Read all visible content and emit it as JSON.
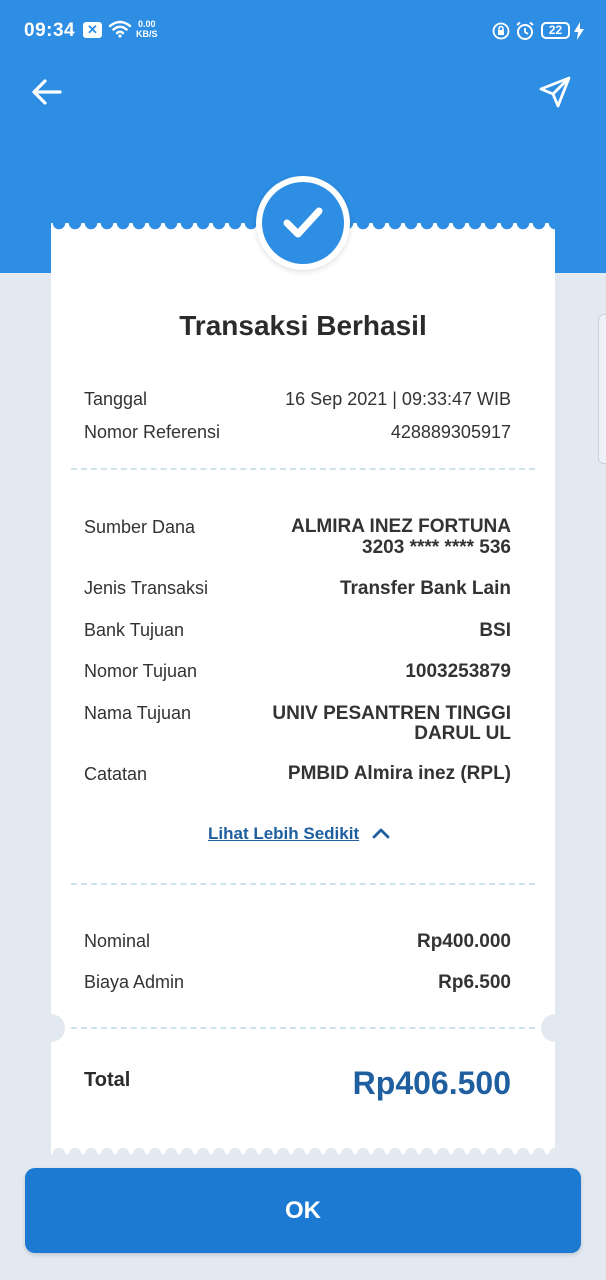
{
  "status_bar": {
    "time": "09:34",
    "notification_icon": "close-box-icon",
    "wifi_icon": "wifi-icon",
    "net_speed_value": "0.00",
    "net_speed_unit": "KB/S",
    "battery_level": "22"
  },
  "header": {
    "back_icon": "arrow-left-icon",
    "share_icon": "send-icon"
  },
  "receipt": {
    "title": "Transaksi Berhasil",
    "date_label": "Tanggal",
    "date_value": "16 Sep 2021 | 09:33:47 WIB",
    "ref_label": "Nomor Referensi",
    "ref_value": "428889305917",
    "source_label": "Sumber Dana",
    "source_name": "ALMIRA INEZ FORTUNA",
    "source_account": "3203 **** **** 536",
    "type_label": "Jenis Transaksi",
    "type_value": "Transfer Bank Lain",
    "bank_label": "Bank Tujuan",
    "bank_value": "BSI",
    "dest_number_label": "Nomor Tujuan",
    "dest_number_value": "1003253879",
    "dest_name_label": "Nama Tujuan",
    "dest_name_line1": "UNIV PESANTREN TINGGI",
    "dest_name_line2": "DARUL UL",
    "note_label": "Catatan",
    "note_value": "PMBID Almira inez (RPL)",
    "less_link": "Lihat Lebih Sedikit",
    "nominal_label": "Nominal",
    "nominal_value": "Rp400.000",
    "fee_label": "Biaya Admin",
    "fee_value": "Rp6.500",
    "total_label": "Total",
    "total_value": "Rp406.500"
  },
  "actions": {
    "ok_label": "OK"
  },
  "colors": {
    "header_blue": "#2d8ee3",
    "button_blue": "#1c7ad2",
    "total_blue": "#1f5fa0",
    "background": "#e3e9f1"
  }
}
